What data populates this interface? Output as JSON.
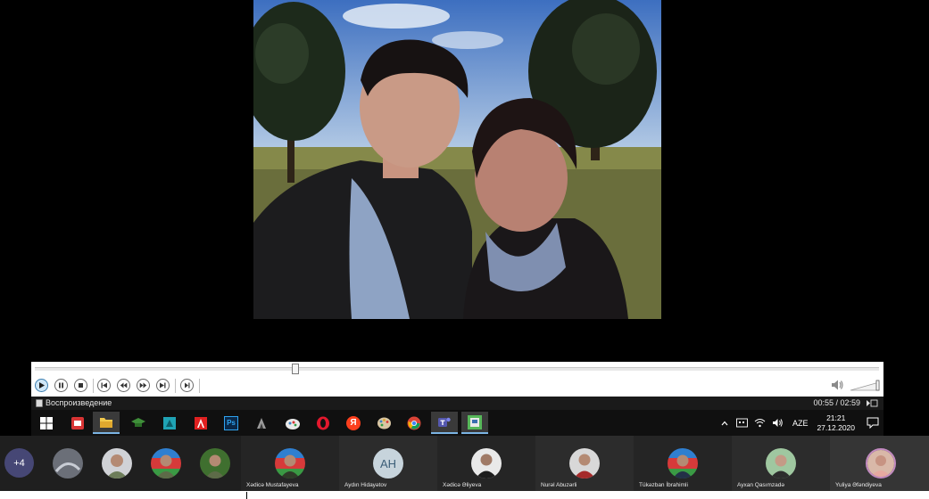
{
  "player": {
    "status_text": "Воспроизведение",
    "time_display": "00:55 / 02:59",
    "progress_fraction": 0.307
  },
  "taskbar": {
    "apps": [
      {
        "icon": "windows-start-icon"
      },
      {
        "icon": "pdf-reader-icon"
      },
      {
        "icon": "file-explorer-icon"
      },
      {
        "icon": "graduation-cap-icon"
      },
      {
        "icon": "media-app-icon"
      },
      {
        "icon": "adobe-acrobat-icon"
      },
      {
        "icon": "photoshop-icon"
      },
      {
        "icon": "inkscape-like-icon"
      },
      {
        "icon": "paint-app-icon"
      },
      {
        "icon": "opera-icon"
      },
      {
        "icon": "yandex-browser-icon"
      },
      {
        "icon": "paint-palette-icon"
      },
      {
        "icon": "chrome-icon"
      },
      {
        "icon": "teams-icon"
      },
      {
        "icon": "media-player-icon"
      }
    ],
    "photoshop_label": "Ps",
    "yandex_label": "Я",
    "language": "AZE",
    "time": "21:21",
    "date": "27.12.2020"
  },
  "participants": {
    "overflow_count": "+4",
    "named": [
      {
        "name": "Xədicə Mustafayeva"
      },
      {
        "name": "Aydın Hidayətov",
        "initials": "AH"
      },
      {
        "name": "Xədicə Əliyeva"
      },
      {
        "name": "Nurəl Abuzərli"
      },
      {
        "name": "Tükəzban İbrahimli"
      },
      {
        "name": "Ayxan Qasımzadə"
      },
      {
        "name": "Yuliya Əfəndiyeva"
      }
    ]
  },
  "colors": {
    "teams_accent": "#464775",
    "seek_bar": "#e8e8e8",
    "status_bar": "#1a1a1a"
  }
}
